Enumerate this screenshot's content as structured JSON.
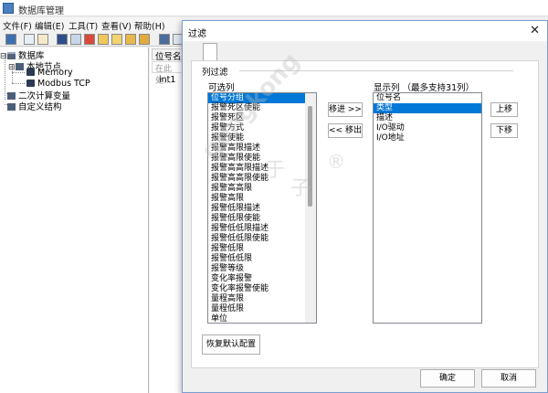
{
  "app": {
    "title": "数据库管理"
  },
  "menu": {
    "items": [
      "文件(F)",
      "编辑(E)",
      "工具(T)",
      "查看(V)",
      "帮助(H)"
    ]
  },
  "tree": {
    "root": "数据库",
    "local_node": "本地节点",
    "devices": [
      "Memory",
      "Modbus TCP"
    ],
    "secondary": "二次计算变量",
    "custom": "自定义结构"
  },
  "grid": {
    "header": "位号名",
    "filter_placeholder": "在此处...",
    "rows": [
      "int1"
    ]
  },
  "dialog": {
    "title": "过滤",
    "close": "✕",
    "group_label": "列过滤",
    "available_label": "可选列",
    "shown_label": "显示列  （最多支持31列）",
    "available_columns": [
      "位号分组",
      "报警死区使能",
      "报警死区",
      "报警方式",
      "报警使能",
      "报警高限描述",
      "报警高限使能",
      "报警高高限描述",
      "报警高高限使能",
      "报警高高限",
      "报警高限",
      "报警低限描述",
      "报警低限使能",
      "报警低低限描述",
      "报警低低限使能",
      "报警低限",
      "报警低低限",
      "报警等级",
      "变化率报警",
      "变化率报警使能",
      "量程高限",
      "量程低限",
      "单位"
    ],
    "available_selected": 0,
    "shown_columns": [
      "位号名",
      "类型",
      "描述",
      "I/O驱动",
      "I/O地址"
    ],
    "shown_selected": 1,
    "move_in": "移进 >>",
    "move_out": "<< 移出",
    "up": "上移",
    "down": "下移",
    "restore": "恢复默认配置",
    "ok": "确定",
    "cancel": "取消"
  },
  "watermark": {
    "text": "gongkong",
    "reg": "®",
    "zi": "子",
    "qian": "于"
  }
}
